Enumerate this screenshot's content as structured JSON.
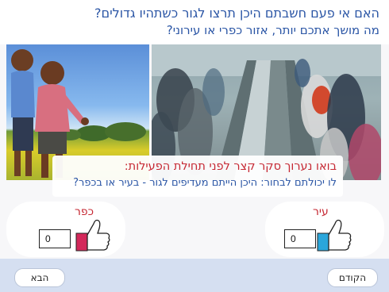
{
  "question": {
    "line1": "האם אי פעם חשבתם היכן תרצו לגור כשתהיו גדולים?",
    "line2": "מה מושך אתכם יותר, אזור כפרי או עירוני?"
  },
  "banner": {
    "title": "בואו נערוך סקר קצר לפני תחילת הפעילות:",
    "subtitle": "לו יכולתם לבחור: היכן הייתם מעדיפים לגור - בעיר או בכפר?"
  },
  "votes": {
    "village": {
      "label": "כפר",
      "count": "0",
      "color": "#d3285a"
    },
    "city": {
      "label": "עיר",
      "count": "0",
      "color": "#2aa6db"
    }
  },
  "footer": {
    "next_label": "הבא",
    "prev_label": "הקודם"
  }
}
